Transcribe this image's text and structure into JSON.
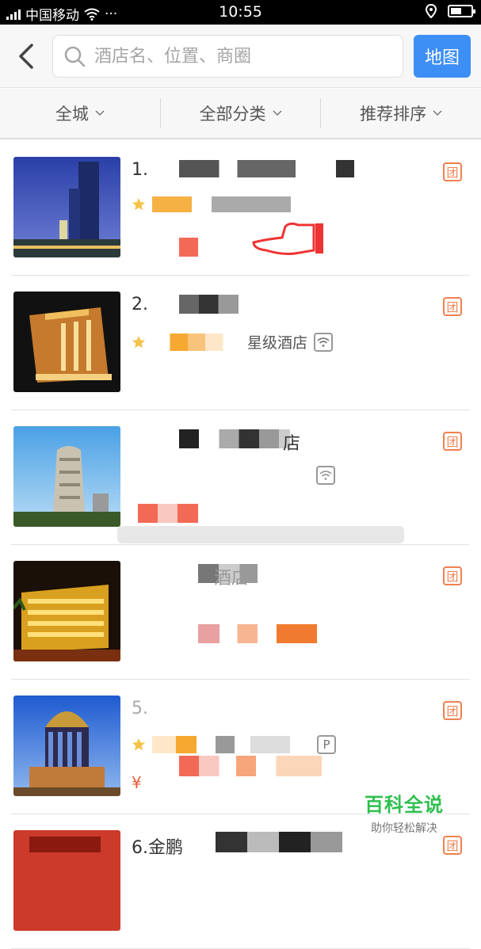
{
  "status_bar": {
    "carrier": "中国移动",
    "time": "10:55",
    "more": "···"
  },
  "search": {
    "placeholder": "酒店名、位置、商圈"
  },
  "header": {
    "map_label": "地图"
  },
  "filters": [
    {
      "label": "全城"
    },
    {
      "label": "全部分类"
    },
    {
      "label": "推荐排序"
    }
  ],
  "hotels": [
    {
      "name": "1.",
      "tag": "团",
      "level": "",
      "price": "",
      "amenity": ""
    },
    {
      "name": "2.",
      "tag": "团",
      "level": "星级酒店",
      "price": "",
      "amenity": "wifi"
    },
    {
      "name": "店",
      "tag": "团",
      "level": "",
      "price": "",
      "amenity": "wifi"
    },
    {
      "name": "酒店",
      "tag": "团",
      "level": "",
      "price": "",
      "amenity": ""
    },
    {
      "name": "5.",
      "tag": "团",
      "level": "",
      "price": "¥",
      "amenity": "P"
    },
    {
      "name": "6.金鹏",
      "tag": "团",
      "level": "",
      "price": "",
      "amenity": ""
    }
  ],
  "watermark": {
    "title": "百科全说",
    "subtitle": "助你轻松解决"
  },
  "colors": {
    "accent": "#3d8ef5",
    "tag": "#f08050",
    "price": "#f05a3a",
    "watermark": "#2fbf4f"
  }
}
